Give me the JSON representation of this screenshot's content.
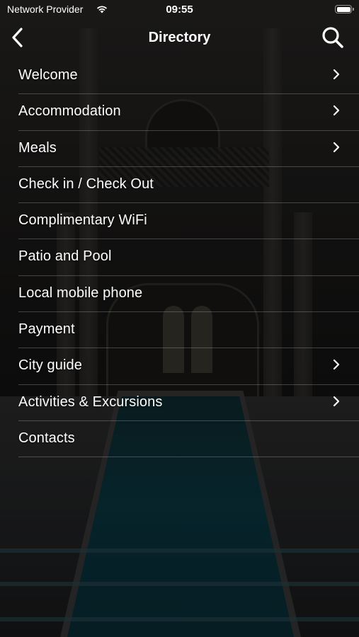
{
  "status_bar": {
    "carrier": "Network Provider",
    "time": "09:55",
    "wifi_icon": "wifi-icon",
    "battery_icon": "battery-full-icon"
  },
  "nav": {
    "title": "Directory",
    "back_icon": "chevron-left-icon",
    "search_icon": "search-icon"
  },
  "items": [
    {
      "label": "Welcome",
      "has_chevron": true
    },
    {
      "label": "Accommodation",
      "has_chevron": true
    },
    {
      "label": "Meals",
      "has_chevron": true
    },
    {
      "label": "Check in / Check Out",
      "has_chevron": false
    },
    {
      "label": "Complimentary WiFi",
      "has_chevron": false
    },
    {
      "label": "Patio and Pool",
      "has_chevron": false
    },
    {
      "label": "Local mobile phone",
      "has_chevron": false
    },
    {
      "label": "Payment",
      "has_chevron": false
    },
    {
      "label": "City guide",
      "has_chevron": true
    },
    {
      "label": "Activities & Excursions",
      "has_chevron": true
    },
    {
      "label": "Contacts",
      "has_chevron": false
    }
  ],
  "colors": {
    "text": "#ffffff",
    "separator": "rgba(255,255,255,0.22)",
    "pool": "#0b3a45"
  }
}
